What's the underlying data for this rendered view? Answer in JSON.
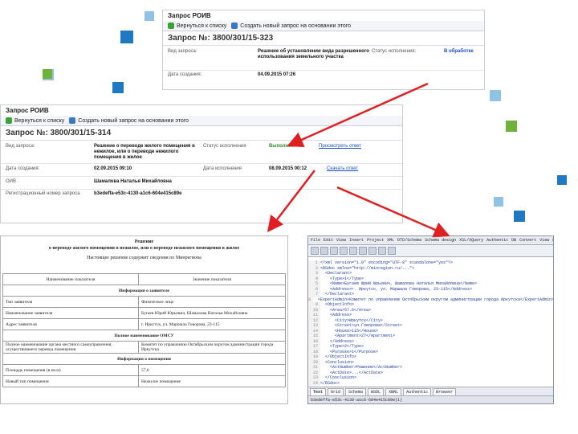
{
  "colors": {
    "arrow": "#e02020",
    "accent_blue": "#1f78c1",
    "accent_green": "#6fb23a",
    "light_blue": "#8fc3e3"
  },
  "shot1": {
    "title": "Запрос РОИВ",
    "toolbar": {
      "back": "Вернуться к списку",
      "create": "Создать новый запрос на основании этого"
    },
    "req_title": "Запрос №: 3800/301/15-323",
    "type_label": "Вид запроса:",
    "type_value": "Решение об установлении вида разрешенного использования земельного участка",
    "status_label": "Статус исполнения:",
    "status_value": "В обработке",
    "created_label": "Дата создания:",
    "created_value": "04.09.2015 07:26"
  },
  "shot2": {
    "title": "Запрос РОИВ",
    "toolbar": {
      "back": "Вернуться к списку",
      "create": "Создать новый запрос на основании этого"
    },
    "req_title": "Запрос №: 3800/301/15-314",
    "type_label": "Вид запроса:",
    "type_value": "Решение о переводе жилого помещения в нежилое, или о переводе нежилого помещения в жилое",
    "status_label": "Статус исполнения",
    "status_value": "Выполнен",
    "print_link": "Просмотреть ответ",
    "created_label": "Дата создания:",
    "created_value": "02.09.2015 09:10",
    "exec_label": "Дата исполнения",
    "exec_value": "08.09.2015 00:12",
    "xml_link": "Скачать ответ",
    "oiv_label": "ОИВ",
    "oiv_value": "Шамалова Наталья Михайловна",
    "reg_label": "Регистрационный номер запроса",
    "reg_value": "b3edeffa-e53c-4130-a1c6-604e415c89e"
  },
  "doc": {
    "heading1": "Решение",
    "heading2": "о переводе жилого помещения в нежилое, или о переводе нежилого помещения в жилое",
    "sub": "Настоящее решение содержит сведения по Минрегиона",
    "col_name": "Наименование показателя",
    "col_value": "Значение показателя",
    "section_applicant": "Информация о заявителе",
    "row_type": "Тип заявителя",
    "row_type_val": "Физическое лицо",
    "row_name": "Наименование заявителя",
    "row_name_val": "Бугаев Юрий Юрьевич, Шамалова Наталья Михайловна",
    "row_addr": "Адрес заявителя",
    "row_addr_val": "г. Иркутск, ул. Маршала Говорова, 23-115",
    "section_omsu": "Полное наименование ОМСУ",
    "row_omsu": "Полное наименование органа местного самоуправления, осуществившего перевод помещения",
    "row_omsu_val": "Комитет по управлению Октябрьским округом администрации города Иркутска",
    "section_room": "Информация о помещении",
    "row_area": "Площадь помещения (в кв.м)",
    "row_area_val": "57,6",
    "row_newtype": "Новый тип помещения",
    "row_newtype_val": "Нежилое помещение"
  },
  "xml": {
    "menu": [
      "File",
      "Edit",
      "View",
      "Insert",
      "Project",
      "XML",
      "DTD/Schema",
      "Schema design",
      "XSL/XQuery",
      "Authentic",
      "DB",
      "Convert",
      "View",
      "Browser",
      "WSDL",
      "SOAP",
      "Tools",
      "Window",
      "Help"
    ],
    "lines": [
      "<?xml version=\"1.0\" encoding=\"UTF-8\" standalone=\"yes\"?>",
      "<RSdoc xmlns=\"http://minregion.ru/...\">",
      "  <Declarant>",
      "    <Type>1</Type>",
      "    <Name>Бугаев Юрий Юрьевич, Шамалова Наталья Михайловна</Name>",
      "    <Address>г. Иркутск, ул. Маршала Говорова, 23-115</Address>",
      "  </Declarant>",
      "  <ExpertAdmin>Комитет по управлению Октябрьским округом администрации города Иркутска</ExpertAdmin>",
      "  <ObjectInfo>",
      "    <Area>57.6</Area>",
      "    <Address>",
      "      <City>Иркутск</City>",
      "      <Street>ул.Говорова</Street>",
      "      <House>115</House>",
      "      <Apartment>27</Apartment>",
      "    </Address>",
      "    <Type>2</Type>",
      "    <Purpose>1</Purpose>",
      "  </ObjectInfo>",
      "  <Conclusion>",
      "    <ActNumber>Решение</ActNumber>",
      "    <ActDate>...</ActDate>",
      "  </Conclusion>",
      "</RSdoc>"
    ],
    "line_numbers": [
      "1",
      "2",
      "3",
      "4",
      "5",
      "6",
      "7",
      "8",
      "9",
      "10",
      "11",
      "12",
      "13",
      "14",
      "15",
      "16",
      "17",
      "18",
      "19",
      "20",
      "21",
      "22",
      "23",
      "24"
    ],
    "tabs": [
      "Text",
      "Grid",
      "Schema",
      "WSDL",
      "XBRL",
      "Authentic",
      "Browser"
    ],
    "file": "b3edeffa-e53c-4130-a1c6-604e415c89e(1)"
  }
}
